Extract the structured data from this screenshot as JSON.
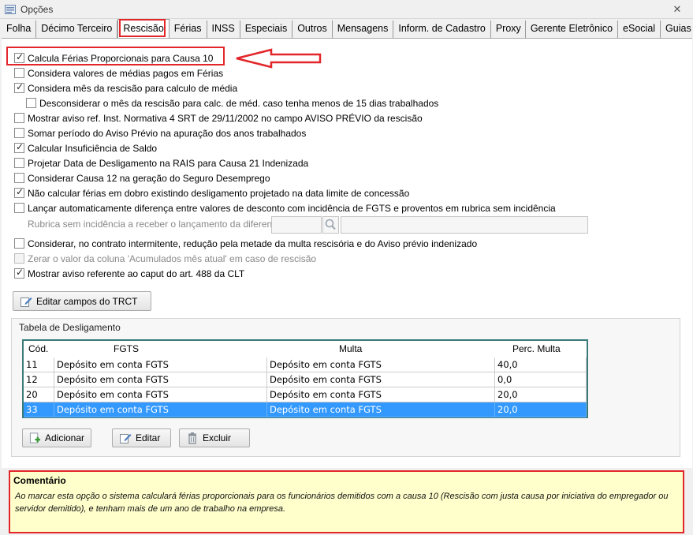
{
  "window": {
    "title": "Opções",
    "close_glyph": "✕"
  },
  "tabs": [
    {
      "label": "Folha"
    },
    {
      "label": "Décimo Terceiro"
    },
    {
      "label": "Rescisão",
      "active": true
    },
    {
      "label": "Férias"
    },
    {
      "label": "INSS"
    },
    {
      "label": "Especiais"
    },
    {
      "label": "Outros"
    },
    {
      "label": "Mensagens"
    },
    {
      "label": "Inform. de Cadastro"
    },
    {
      "label": "Proxy"
    },
    {
      "label": "Gerente Eletrônico"
    },
    {
      "label": "eSocial"
    },
    {
      "label": "Guias"
    }
  ],
  "options": [
    {
      "label": "Calcula Férias Proporcionais para Causa 10",
      "checked": true
    },
    {
      "label": "Considera valores de médias pagos em Férias",
      "checked": false
    },
    {
      "label": "Considera mês da rescisão para calculo de média",
      "checked": true
    },
    {
      "label": "Desconsiderar o mês da rescisão para calc. de méd. caso tenha menos de 15 dias trabalhados",
      "checked": false
    },
    {
      "label": "Mostrar aviso ref. Inst. Normativa 4 SRT de 29/11/2002 no campo AVISO PRÉVIO da rescisão",
      "checked": false
    },
    {
      "label": "Somar período do Aviso Prévio na apuração dos anos trabalhados",
      "checked": false
    },
    {
      "label": "Calcular Insuficiência de Saldo",
      "checked": true
    },
    {
      "label": "Projetar Data de Desligamento na RAIS para Causa 21 Indenizada",
      "checked": false
    },
    {
      "label": "Considerar Causa 12 na geração do Seguro Desemprego",
      "checked": false
    },
    {
      "label": "Não calcular férias em dobro existindo desligamento projetado na data limite de concessão",
      "checked": true
    },
    {
      "label": "Lançar automaticamente diferença entre valores de desconto com incidência de FGTS e proventos em rubrica sem incidência",
      "checked": false
    },
    {
      "label": "Considerar, no contrato intermitente, redução pela metade da multa rescisória e do Aviso prévio indenizado",
      "checked": false
    },
    {
      "label": "Zerar o valor da coluna 'Acumulados mês atual' em caso de rescisão",
      "checked": false,
      "disabled": true
    },
    {
      "label": "Mostrar aviso referente ao caput do art. 488 da CLT",
      "checked": true
    }
  ],
  "rubrica": {
    "label": "Rubrica sem incidência a receber o lançamento da diferença:"
  },
  "buttons": {
    "edit_trct": "Editar campos do TRCT",
    "add": "Adicionar",
    "edit": "Editar",
    "delete": "Excluir"
  },
  "table": {
    "title": "Tabela de Desligamento",
    "columns": [
      "Cód.",
      "FGTS",
      "Multa",
      "Perc. Multa"
    ],
    "rows": [
      {
        "cod": "11",
        "fgts": "Depósito em conta FGTS",
        "multa": "Depósito em conta FGTS",
        "perc": "40,0"
      },
      {
        "cod": "12",
        "fgts": "Depósito em conta FGTS",
        "multa": "Depósito em conta FGTS",
        "perc": "0,0"
      },
      {
        "cod": "20",
        "fgts": "Depósito em conta FGTS",
        "multa": "Depósito em conta FGTS",
        "perc": "20,0"
      },
      {
        "cod": "33",
        "fgts": "Depósito em conta FGTS",
        "multa": "Depósito em conta FGTS",
        "perc": "20,0",
        "selected": true
      }
    ]
  },
  "comment": {
    "title": "Comentário",
    "text": "Ao marcar esta opção o sistema calculará férias proporcionais para os funcionários demitidos com a causa 10 (Rescisão com justa causa por iniciativa do empregador ou servidor demitido), e tenham mais de um ano de trabalho na empresa."
  },
  "colors": {
    "highlight": "#e3262a",
    "selection": "#3399ff",
    "grid_border": "#3a7a78",
    "comment_bg": "#ffffcc"
  }
}
